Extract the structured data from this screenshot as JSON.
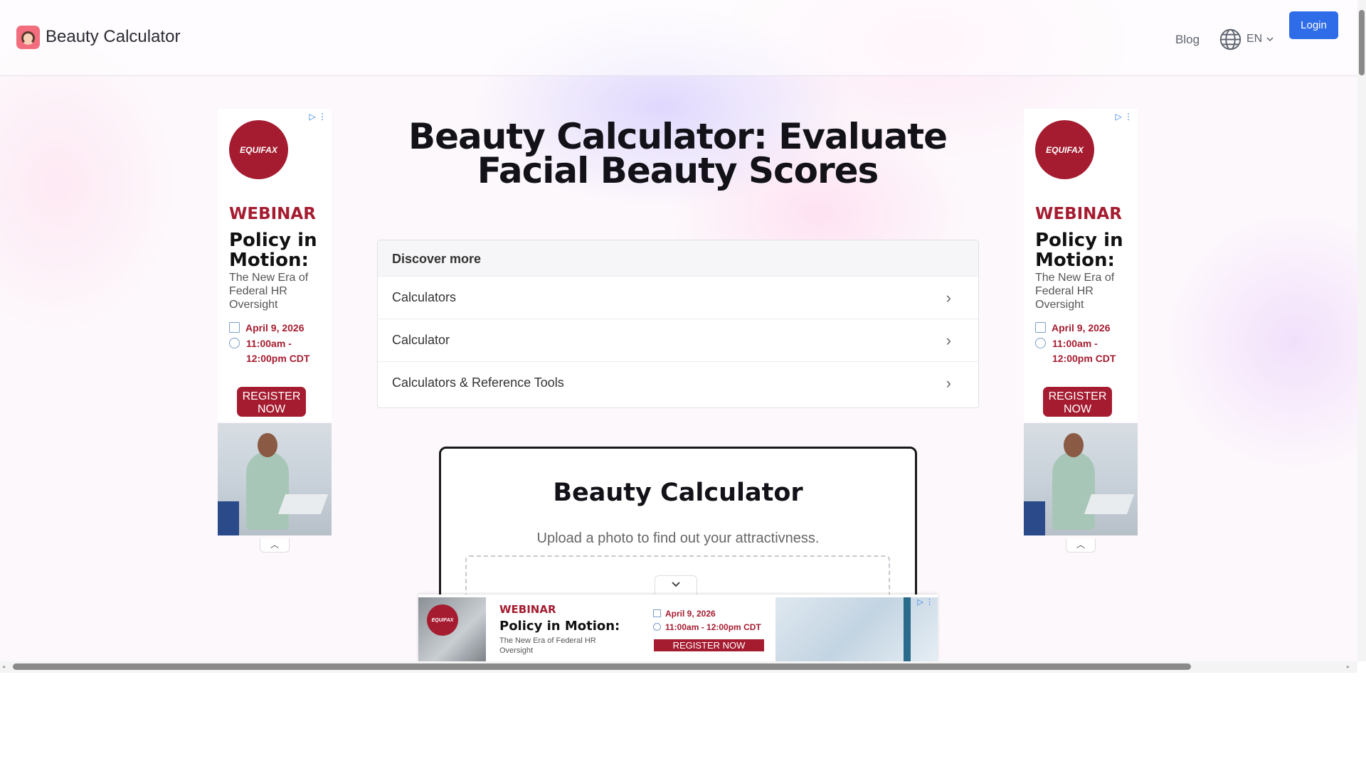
{
  "header": {
    "app_name": "Beauty Calculator",
    "nav_blog": "Blog",
    "language": "EN",
    "login_label": "Login"
  },
  "main": {
    "title": "Beauty Calculator: Evaluate Facial Beauty Scores",
    "discover": {
      "heading": "Discover more",
      "items": [
        {
          "label": "Calculators"
        },
        {
          "label": "Calculator"
        },
        {
          "label": "Calculators & Reference Tools"
        }
      ]
    },
    "calculator": {
      "title": "Beauty Calculator",
      "subtitle": "Upload a photo to find out your attractivness."
    }
  },
  "ad": {
    "brand": "EQUIFAX",
    "tag": "WEBINAR",
    "headline": "Policy in Motion:",
    "subline": "The New Era of Federal HR Oversight",
    "date": "April 9, 2026",
    "time": "11:00am - 12:00pm CDT",
    "cta": "REGISTER NOW",
    "adchoices_icon": "adchoices-icon",
    "menu_icon": "more-vertical-icon"
  },
  "colors": {
    "accent": "#2e6ce8",
    "ad_brand": "#a51c30",
    "text_dark": "#121218"
  }
}
